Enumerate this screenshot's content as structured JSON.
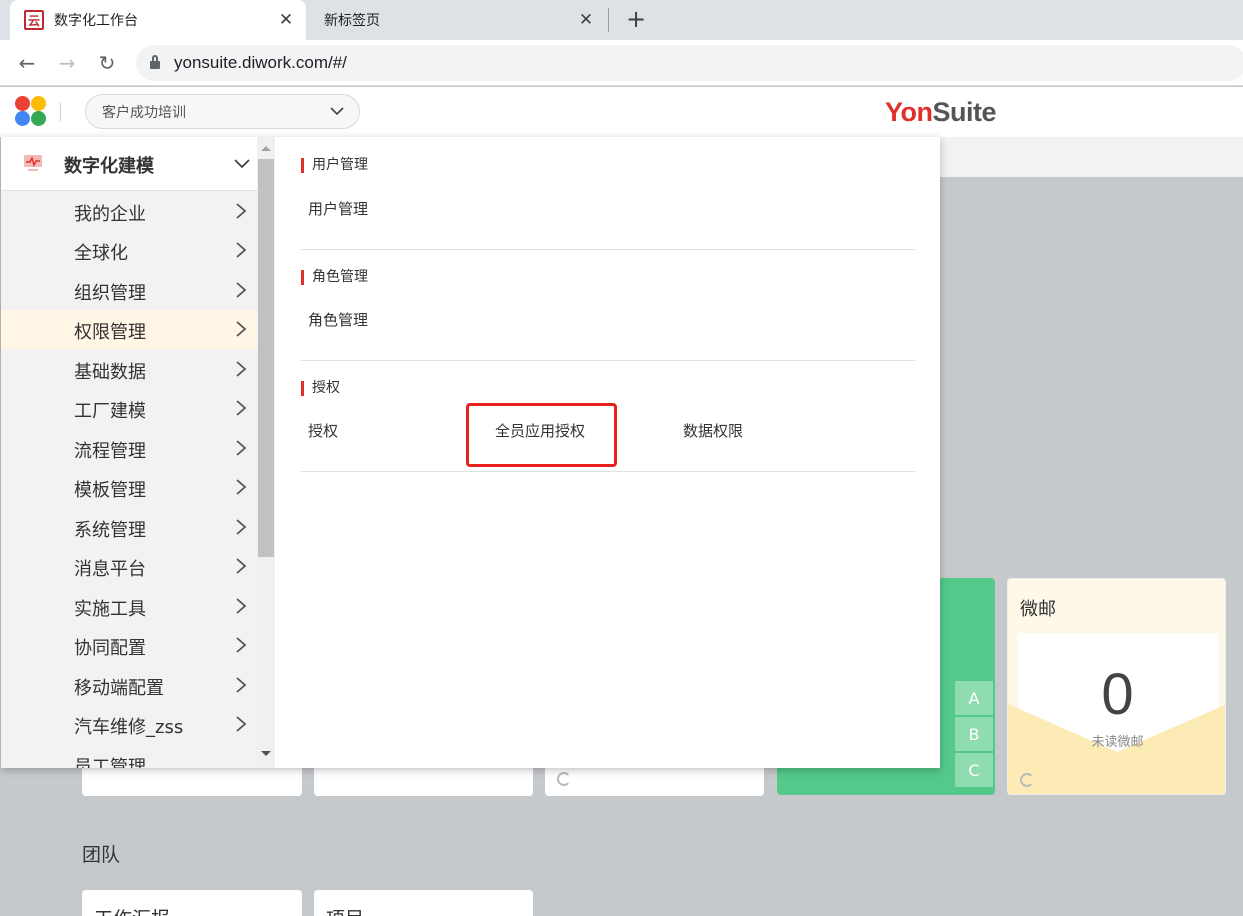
{
  "browser": {
    "tabs": [
      {
        "title": "数字化工作台",
        "favicon": "云",
        "active": true
      },
      {
        "title": "新标签页",
        "active": false
      }
    ],
    "url": "yonsuite.diwork.com/#/"
  },
  "header": {
    "tenant": "客户成功培训",
    "brand_yon": "Yon",
    "brand_suite": "Suite"
  },
  "sidebar": {
    "title": "数字化建模",
    "items": [
      {
        "label": "我的企业"
      },
      {
        "label": "全球化"
      },
      {
        "label": "组织管理"
      },
      {
        "label": "权限管理",
        "selected": true
      },
      {
        "label": "基础数据"
      },
      {
        "label": "工厂建模"
      },
      {
        "label": "流程管理"
      },
      {
        "label": "模板管理"
      },
      {
        "label": "系统管理"
      },
      {
        "label": "消息平台"
      },
      {
        "label": "实施工具"
      },
      {
        "label": "协同配置"
      },
      {
        "label": "移动端配置"
      },
      {
        "label": "汽车维修_zss"
      },
      {
        "label": "员工管理"
      }
    ]
  },
  "sections": [
    {
      "title": "用户管理",
      "links": [
        "用户管理"
      ]
    },
    {
      "title": "角色管理",
      "links": [
        "角色管理"
      ]
    },
    {
      "title": "授权",
      "links": [
        "授权",
        "全员应用授权",
        "数据权限"
      ]
    }
  ],
  "workspace": {
    "mail_title": "微邮",
    "mail_count": "0",
    "mail_sub": "未读微邮",
    "letters": [
      "A",
      "B",
      "C"
    ],
    "team_label": "团队",
    "cards": [
      "工作汇报",
      "项目"
    ]
  },
  "colors": {
    "accent": "#e0302a",
    "highlight": "#e8201e",
    "selected_bg": "#fff6e5",
    "green": "#54c98a"
  }
}
